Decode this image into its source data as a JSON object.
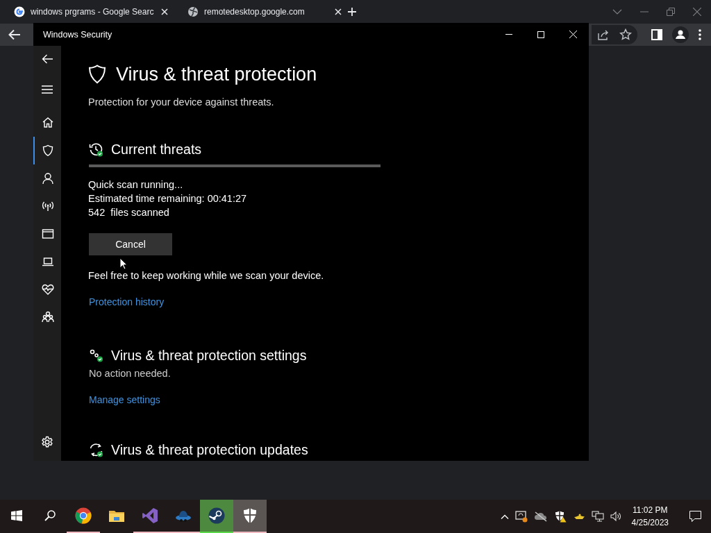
{
  "browser": {
    "tabs": [
      {
        "kind": "google",
        "title": "windows prgrams - Google Searc"
      },
      {
        "kind": "globe",
        "title": "remotedesktop.google.com"
      }
    ]
  },
  "window": {
    "title": "Windows Security"
  },
  "nav": [
    {
      "kind": "home",
      "selected": false
    },
    {
      "kind": "shield",
      "selected": true
    },
    {
      "kind": "person",
      "selected": false
    },
    {
      "kind": "network",
      "selected": false
    },
    {
      "kind": "browser",
      "selected": false
    },
    {
      "kind": "laptop",
      "selected": false
    },
    {
      "kind": "health",
      "selected": false
    },
    {
      "kind": "family",
      "selected": false
    }
  ],
  "page": {
    "title": "Virus & threat protection",
    "subtitle": "Protection for your device against threats.",
    "current_threats": {
      "heading": "Current threats",
      "status": "Quick scan running...",
      "eta": "Estimated time remaining: 00:41:27",
      "files": "542  files scanned",
      "progress": {
        "level": 1
      },
      "button": "Cancel",
      "note": "Feel free to keep working while we scan your device.",
      "link": "Protection history"
    },
    "settings": {
      "heading": "Virus & threat protection settings",
      "status": "No action needed.",
      "link": "Manage settings"
    },
    "updates": {
      "heading": "Virus & threat protection updates"
    }
  },
  "taskbar": {
    "apps": [
      {
        "kind": "chrome",
        "running": true,
        "flashing": false,
        "active": false
      },
      {
        "kind": "folder",
        "running": false,
        "flashing": false,
        "active": false
      },
      {
        "kind": "studio",
        "running": true,
        "flashing": false,
        "active": false
      },
      {
        "kind": "hat",
        "running": true,
        "flashing": false,
        "active": false
      },
      {
        "kind": "steam",
        "running": true,
        "flashing": true,
        "active": false
      },
      {
        "kind": "defender",
        "running": true,
        "flashing": false,
        "active": true
      }
    ],
    "clock": {
      "time": "11:02 PM",
      "date": "4/25/2023"
    }
  }
}
